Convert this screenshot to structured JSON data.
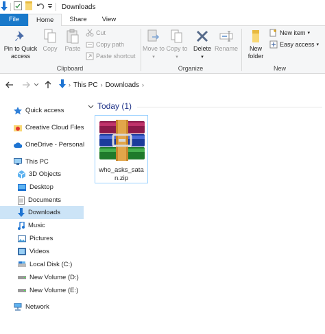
{
  "window": {
    "title": "Downloads"
  },
  "tabs": [
    {
      "label": "File"
    },
    {
      "label": "Home"
    },
    {
      "label": "Share"
    },
    {
      "label": "View"
    }
  ],
  "ribbon": {
    "clipboard": {
      "label": "Clipboard",
      "pin": "Pin to Quick access",
      "copy": "Copy",
      "paste": "Paste",
      "cut": "Cut",
      "copy_path": "Copy path",
      "paste_shortcut": "Paste shortcut"
    },
    "organize": {
      "label": "Organize",
      "move_to": "Move to",
      "copy_to": "Copy to",
      "delete": "Delete",
      "rename": "Rename"
    },
    "new": {
      "label": "New",
      "new_folder": "New folder",
      "new_item": "New item",
      "easy_access": "Easy access"
    }
  },
  "address": {
    "crumbs": [
      "This PC",
      "Downloads"
    ]
  },
  "nav": {
    "quick_access": "Quick access",
    "creative_cloud": "Creative Cloud Files",
    "onedrive": "OneDrive - Personal",
    "this_pc": "This PC",
    "objects3d": "3D Objects",
    "desktop": "Desktop",
    "documents": "Documents",
    "downloads": "Downloads",
    "music": "Music",
    "pictures": "Pictures",
    "videos": "Videos",
    "local_disk": "Local Disk (C:)",
    "volume_d": "New Volume (D:)",
    "volume_e": "New Volume (E:)",
    "network": "Network"
  },
  "content": {
    "group_header": "Today (1)",
    "files": [
      {
        "name": "who_asks_satan.zip",
        "icon": "winrar-archive-icon"
      }
    ]
  },
  "colors": {
    "accent": "#1979ca",
    "selection": "#cce4f7",
    "group_header": "#1e3287"
  }
}
